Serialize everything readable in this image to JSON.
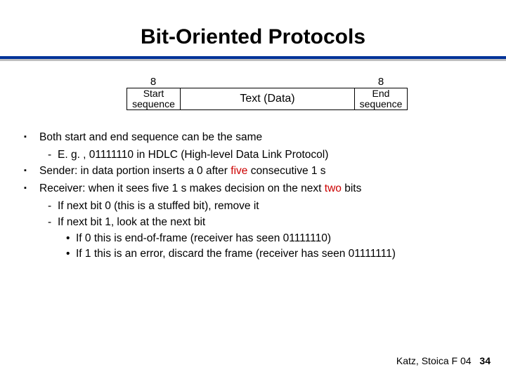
{
  "title": "Bit-Oriented Protocols",
  "diagram": {
    "bits_left": "8",
    "bits_right": "8",
    "start": "Start sequence",
    "data": "Text (Data)",
    "end": "End sequence"
  },
  "bullets": {
    "b1": "Both start and end sequence can be the same",
    "b1a": "E. g. , 01111110 in HDLC (High-level Data Link Protocol)",
    "b2_pre": "Sender: in data portion inserts a 0 after ",
    "b2_red": "five",
    "b2_post": " consecutive 1 s",
    "b3_pre": "Receiver: when it sees five 1 s makes decision on the next ",
    "b3_red": "two",
    "b3_post": " bits",
    "b3a": "If next bit 0 (this is a stuffed bit), remove it",
    "b3b": "If next bit 1, look at the next bit",
    "b3b1": "If 0 this is end-of-frame (receiver has seen 01111110)",
    "b3b2": "If 1 this is an error, discard the frame (receiver has seen 01111111)"
  },
  "footer": {
    "credit": "Katz, Stoica F 04",
    "page": "34"
  }
}
